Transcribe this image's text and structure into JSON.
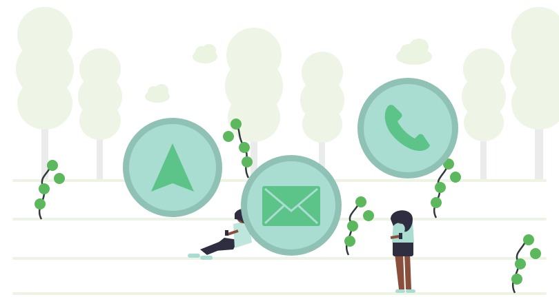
{
  "scene": {
    "colors": {
      "tree": "#eef5e6",
      "trunk": "#eaeaea",
      "ground_line": "#f1f6ea",
      "circle_ring": "#8fc1b5",
      "circle_fill": "#a9ddd1",
      "icon_green": "#5cc389",
      "vine_leaf": "#5cb85c",
      "vine_stem": "#2f3a3a",
      "skin": "#8a4f3c",
      "hair": "#2f2e41",
      "shirt": "#a9ddd1",
      "pants": "#2f2e41"
    },
    "icons": {
      "navigation": "navigation-arrow-icon",
      "mail": "mail-icon",
      "phone": "phone-icon"
    }
  }
}
